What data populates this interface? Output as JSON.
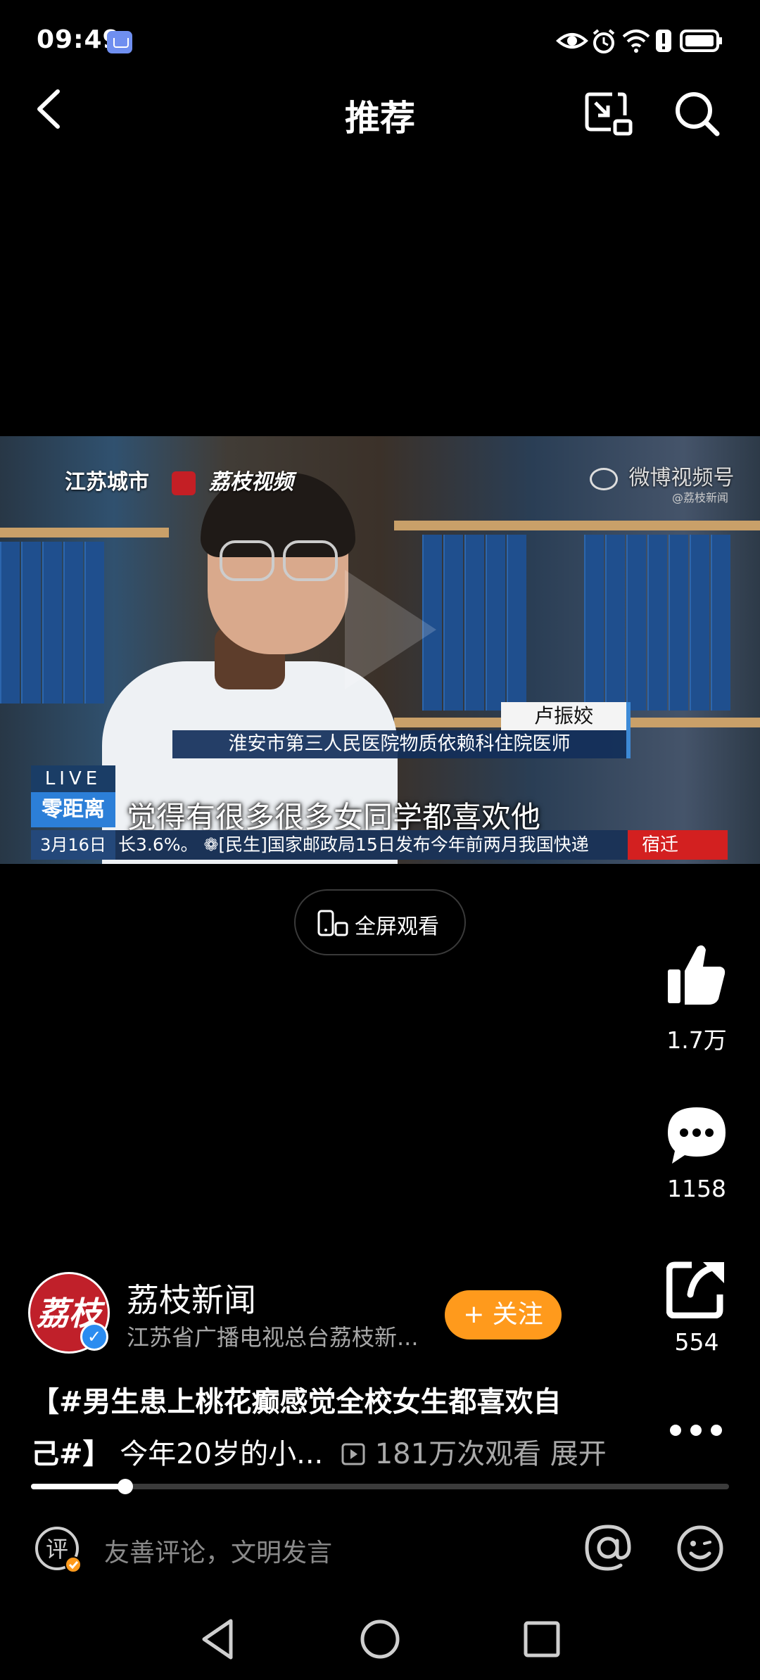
{
  "status_bar": {
    "time": "09:49",
    "icons": [
      "eye-icon",
      "alarm-icon",
      "wifi-icon",
      "alert-icon",
      "battery-icon"
    ]
  },
  "header": {
    "title": "推荐",
    "back_icon": "chevron-left-icon",
    "pip_icon": "picture-in-picture-icon",
    "search_icon": "search-icon"
  },
  "video": {
    "watermark_left": "江苏城市",
    "watermark_brand": "荔枝视频",
    "watermark_right": "微博视频号",
    "watermark_right_sub": "@荔枝新闻",
    "name_tag": "卢振姣",
    "title_bar": "淮安市第三人民医院物质依赖科住院医师",
    "live_label": "LIVE",
    "program_logo": "零距离",
    "subtitle": "觉得有很多很多女同学都喜欢他",
    "ticker_date": "3月16日",
    "ticker_text": "长3.6%。 ❁[民生]国家邮政局15日发布今年前两月我国快递",
    "ticker_location": "宿迁"
  },
  "fullscreen": {
    "label": "全屏观看"
  },
  "actions": {
    "like_count": "1.7万",
    "comment_count": "1158",
    "share_count": "554"
  },
  "author": {
    "avatar_text": "荔枝",
    "name": "荔枝新闻",
    "description": "江苏省广播电视总台荔枝新...",
    "follow_label": "+ 关注"
  },
  "caption": {
    "line1": "【#男生患上桃花癫感觉全校女生都喜欢自",
    "line2_tag_end": "己#】",
    "line2_text": "今年20岁的小...",
    "views": "181万次观看",
    "expand": "展开"
  },
  "progress": {
    "fraction": 0.135
  },
  "comment_bar": {
    "icon_text": "评",
    "placeholder": "友善评论，文明发言"
  },
  "nav": [
    "back-triangle-icon",
    "home-circle-icon",
    "recents-square-icon"
  ]
}
